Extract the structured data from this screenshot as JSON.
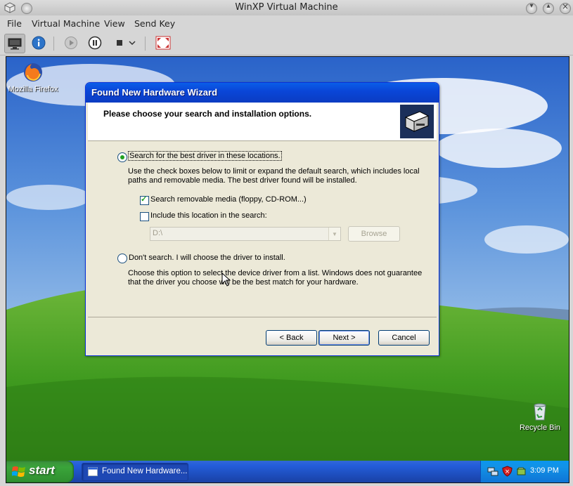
{
  "window": {
    "title": "WinXP Virtual Machine"
  },
  "menu": [
    "File",
    "Virtual Machine",
    "View",
    "Send Key"
  ],
  "toolbar": {
    "icons": [
      "display-icon",
      "info-icon",
      "play-icon",
      "pause-icon",
      "stop-icon",
      "chevron-down-icon",
      "fullscreen-icon"
    ]
  },
  "desktop": {
    "icons": [
      {
        "label": "Mozilla Firefox",
        "icon": "firefox-icon"
      },
      {
        "label": "Recycle Bin",
        "icon": "recycle-bin-icon"
      }
    ]
  },
  "dialog": {
    "title": "Found New Hardware Wizard",
    "heading": "Please choose your search and installation options.",
    "option_search": {
      "label": "Search for the best driver in these locations.",
      "selected": true,
      "description": "Use the check boxes below to limit or expand the default search, which includes local paths and removable media. The best driver found will be installed."
    },
    "check_removable": {
      "label": "Search removable media (floppy, CD-ROM...)",
      "checked": true
    },
    "check_location": {
      "label": "Include this location in the search:",
      "checked": false
    },
    "location_value": "D:\\",
    "browse_label": "Browse",
    "option_dont_search": {
      "label": "Don't search. I will choose the driver to install.",
      "selected": false,
      "description": "Choose this option to select the device driver from a list.  Windows does not guarantee that the driver you choose will be the best match for your hardware."
    },
    "buttons": {
      "back": "< Back",
      "next": "Next >",
      "cancel": "Cancel"
    }
  },
  "taskbar": {
    "start_label": "start",
    "task_label": "Found New Hardware...",
    "clock": "3:09 PM"
  },
  "colors": {
    "xp_blue": "#0a46d8",
    "start_green": "#3aa43a",
    "dialog_face": "#ece9d8"
  }
}
